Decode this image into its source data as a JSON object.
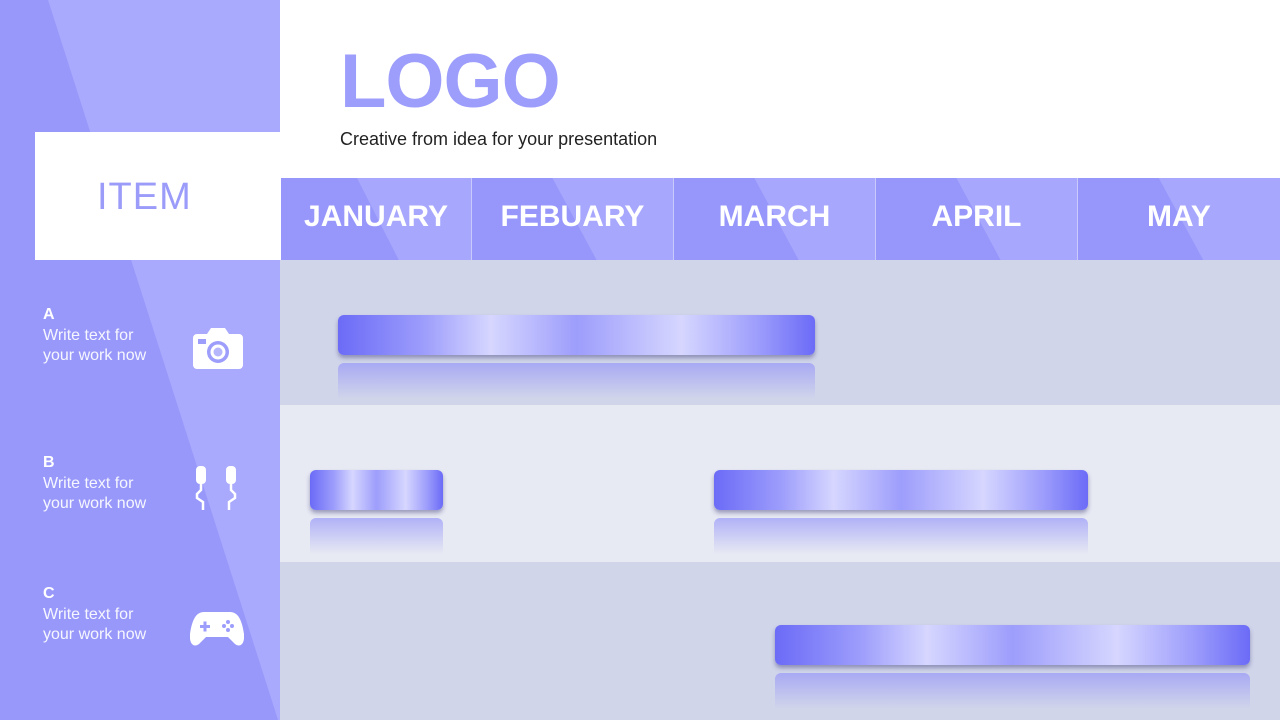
{
  "header": {
    "logo": "LOGO",
    "tagline": "Creative from idea for your presentation"
  },
  "sidebar": {
    "item_title": "ITEM",
    "rows": [
      {
        "letter": "A",
        "text": "Write text for your work now",
        "icon": "camera-icon"
      },
      {
        "letter": "B",
        "text": "Write text for your work now",
        "icon": "earphones-icon"
      },
      {
        "letter": "C",
        "text": "Write text for your work now",
        "icon": "gamepad-icon"
      }
    ]
  },
  "chart_data": {
    "type": "gantt",
    "months": [
      "JANUARY",
      "FEBUARY",
      "MARCH",
      "APRIL",
      "MAY"
    ],
    "tasks": [
      {
        "row": "A",
        "start": 0.3,
        "end": 2.7
      },
      {
        "row": "B",
        "start": 0.15,
        "end": 0.85
      },
      {
        "row": "B",
        "start": 2.2,
        "end": 4.05
      },
      {
        "row": "C",
        "start": 2.5,
        "end": 4.85
      }
    ]
  },
  "colors": {
    "accent": "#9d9dfc",
    "band_dark": "#d1d5ea",
    "band_light": "#e7e9f3",
    "bar_edge": "#6b6bf7",
    "bar_glow": "#d6d6ff"
  }
}
